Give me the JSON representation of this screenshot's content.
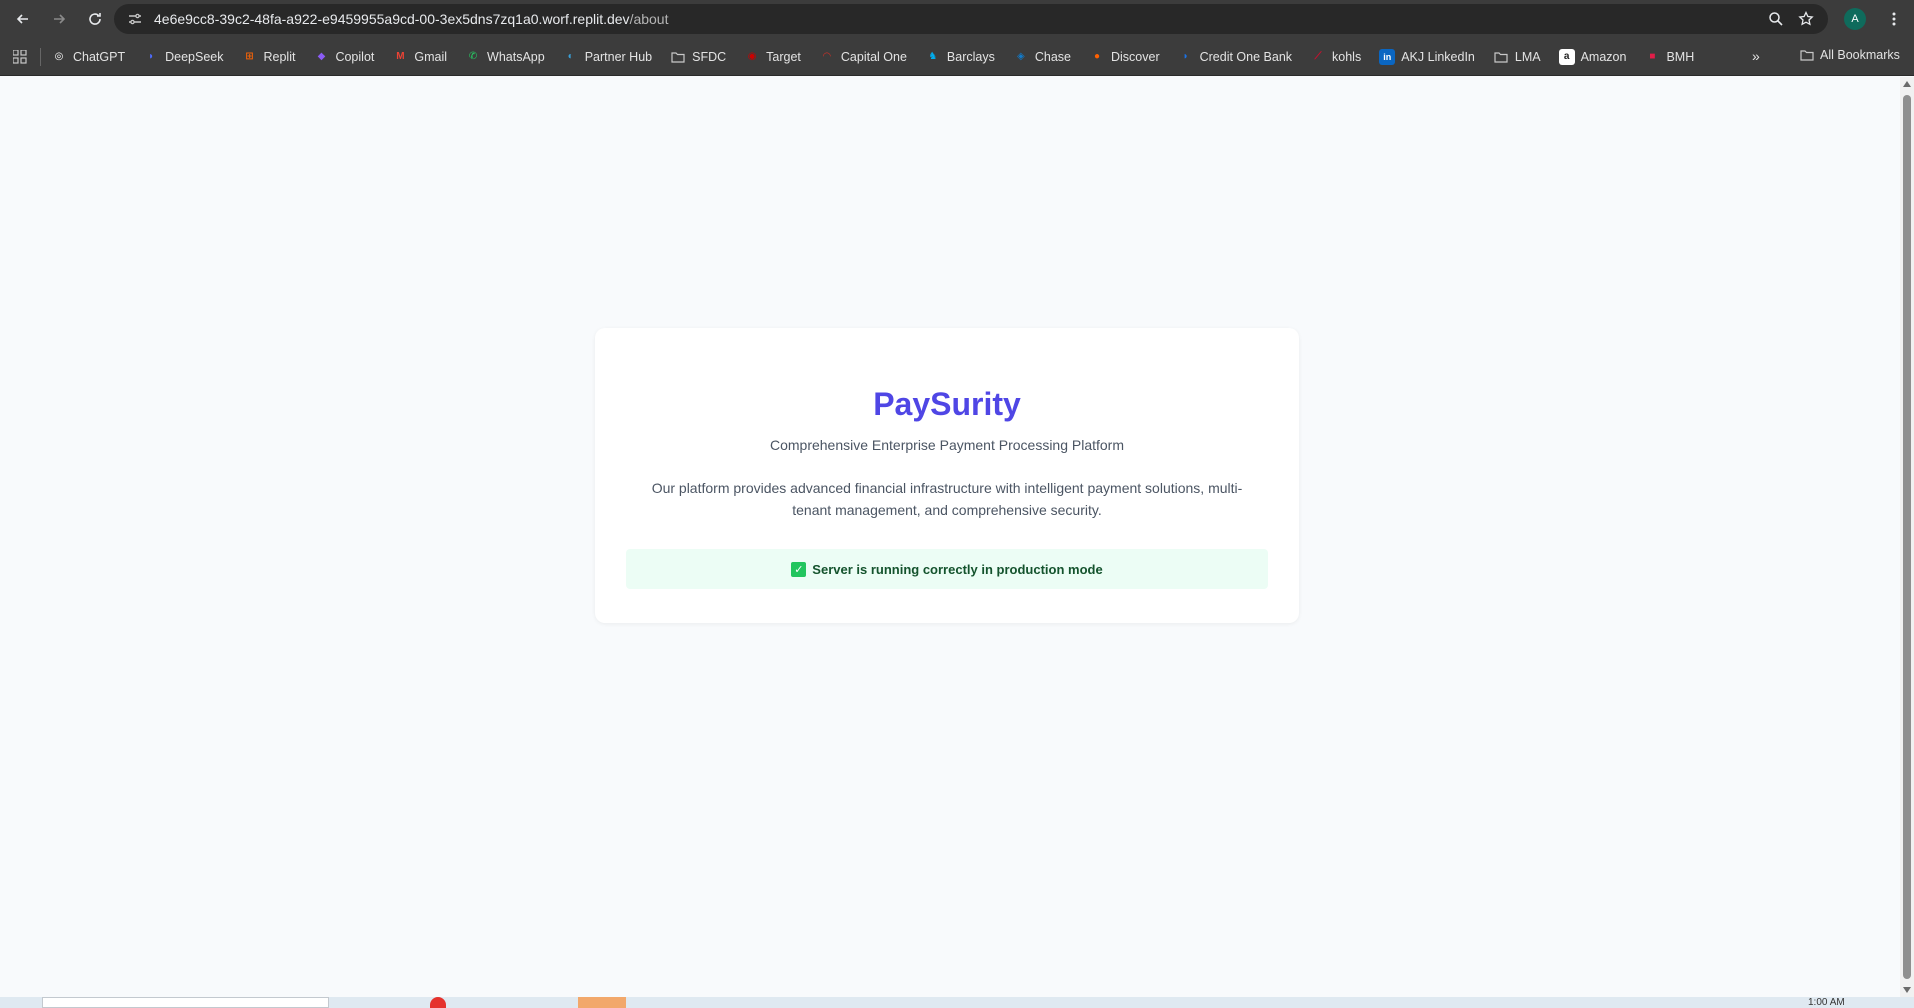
{
  "browser": {
    "url_host": "4e6e9cc8-39c2-48fa-a922-e9459955a9cd-00-3ex5dns7zq1a0.worf.replit.dev",
    "url_path": "/about",
    "avatar_letter": "A"
  },
  "bookmarks": [
    {
      "label": "ChatGPT",
      "icon": "chatgpt-icon",
      "color": "#ffffff"
    },
    {
      "label": "DeepSeek",
      "icon": "deepseek-icon",
      "color": "#4d6bfe"
    },
    {
      "label": "Replit",
      "icon": "replit-icon",
      "color": "#f26207"
    },
    {
      "label": "Copilot",
      "icon": "copilot-icon",
      "color": "#8b5cf6"
    },
    {
      "label": "Gmail",
      "icon": "gmail-icon",
      "color": "#ea4335"
    },
    {
      "label": "WhatsApp",
      "icon": "whatsapp-icon",
      "color": "#25d366"
    },
    {
      "label": "Partner Hub",
      "icon": "partner-hub-icon",
      "color": "#3aa0d8"
    },
    {
      "label": "SFDC",
      "icon": "folder-icon",
      "color": "#c8c8c8"
    },
    {
      "label": "Target",
      "icon": "target-icon",
      "color": "#cc0000"
    },
    {
      "label": "Capital One",
      "icon": "capital-one-icon",
      "color": "#d03027"
    },
    {
      "label": "Barclays",
      "icon": "barclays-icon",
      "color": "#00aeef"
    },
    {
      "label": "Chase",
      "icon": "chase-icon",
      "color": "#117aca"
    },
    {
      "label": "Discover",
      "icon": "discover-icon",
      "color": "#ff6000"
    },
    {
      "label": "Credit One Bank",
      "icon": "credit-one-icon",
      "color": "#1a73e8"
    },
    {
      "label": "kohls",
      "icon": "kohls-icon",
      "color": "#c8102e"
    },
    {
      "label": "AKJ LinkedIn",
      "icon": "linkedin-icon",
      "color": "#0a66c2"
    },
    {
      "label": "LMA",
      "icon": "folder-icon",
      "color": "#c8c8c8"
    },
    {
      "label": "Amazon",
      "icon": "amazon-icon",
      "color": "#ffffff"
    },
    {
      "label": "BMH",
      "icon": "bmh-icon",
      "color": "#e11d48"
    }
  ],
  "bookmarks_all_label": "All Bookmarks",
  "page": {
    "brand": "PaySurity",
    "tagline": "Comprehensive Enterprise Payment Processing Platform",
    "description": "Our platform provides advanced financial infrastructure with intelligent payment solutions, multi-tenant management, and comprehensive security.",
    "status_message": "Server is running correctly in production mode",
    "brand_color": "#4f46e5",
    "status_bg": "#ecfdf5"
  },
  "taskbar": {
    "clock": "1:00 AM"
  }
}
